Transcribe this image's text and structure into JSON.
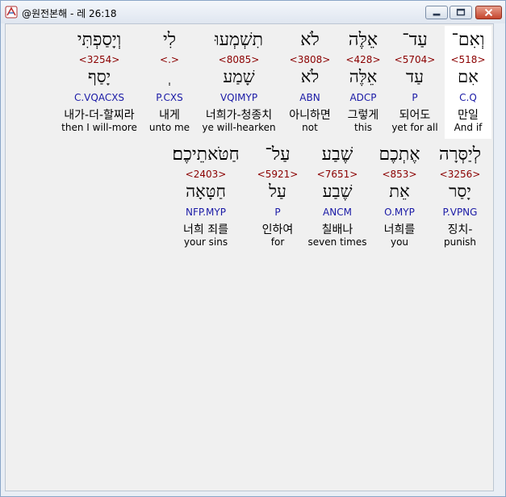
{
  "window": {
    "title": "@원전본해 - 레 26:18"
  },
  "colors": {
    "strong": "#8b0000",
    "morph": "#1a1aa6",
    "selected_bg": "#ffffff",
    "content_bg": "#f0f0f0"
  },
  "icons": {
    "app": "app-icon",
    "minimize": "minimize-icon",
    "maximize": "maximize-icon",
    "close": "close-icon"
  },
  "verse": {
    "row1": [
      {
        "heb": "וְאִם־",
        "strong": "<518>",
        "root": "אִם",
        "morph": "C.Q",
        "kor": "만일",
        "eng": "And if",
        "selected": true
      },
      {
        "heb": "עַד־",
        "strong": "<5704>",
        "root": "עַד",
        "morph": "P",
        "kor": "되어도",
        "eng": "yet for all"
      },
      {
        "heb": "אֵלֶּה",
        "strong": "<428>",
        "root": "אֵלֶּה",
        "morph": "ADCP",
        "kor": "그렇게",
        "eng": "this"
      },
      {
        "heb": "לֹא",
        "strong": "<3808>",
        "root": "לֹא",
        "morph": "ABN",
        "kor": "아니하면",
        "eng": "not"
      },
      {
        "heb": "תִשְׁמְעוּ",
        "strong": "<8085>",
        "root": "שָׁמַע",
        "morph": "VQIMYP",
        "kor": "너희가-청종치",
        "eng": "ye will-hearken"
      },
      {
        "heb": "לִי",
        "strong": "<.>",
        "root": "ְ",
        "morph": "P.CXS",
        "kor": "내게",
        "eng": "unto me"
      },
      {
        "heb": "וְיָסַפְתִּי",
        "strong": "<3254>",
        "root": "יָסַף",
        "morph": "C.VQACXS",
        "kor": "내가-더-할찌라",
        "eng": "then I will-more"
      }
    ],
    "row2": [
      {
        "heb": "לְיַסְּרָה",
        "strong": "<3256>",
        "root": "יָסַר",
        "morph": "P.VPNG",
        "kor": "징치-",
        "eng": "punish"
      },
      {
        "heb": "אֶתְכֶם",
        "strong": "<853>",
        "root": "אֵת",
        "morph": "O.MYP",
        "kor": "너희를",
        "eng": "you"
      },
      {
        "heb": "שֶׁבַע",
        "strong": "<7651>",
        "root": "שֶׁבַע",
        "morph": "ANCM",
        "kor": "칠배나",
        "eng": "seven times"
      },
      {
        "heb": "עַל־",
        "strong": "<5921>",
        "root": "עַל",
        "morph": "P",
        "kor": "인하여",
        "eng": "for"
      },
      {
        "heb": "חַטֹּאתֵיכֶם׃",
        "strong": "<2403>",
        "root": "חַטָּאָה",
        "morph": "NFP.MYP",
        "kor": "너희 죄를",
        "eng": "your sins"
      }
    ]
  }
}
